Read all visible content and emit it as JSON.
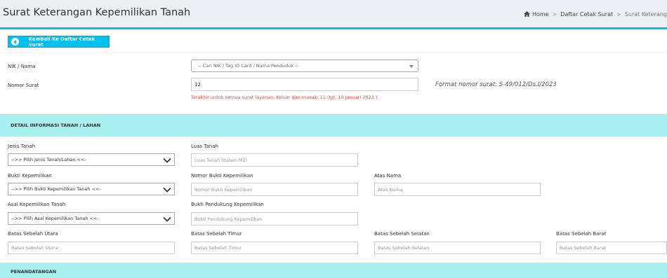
{
  "header": {
    "title": "Surat Keterangan Kepemilikan Tanah",
    "breadcrumb": {
      "home": "Home",
      "parent": "Daftar Cetak Surat",
      "current": "Surat Keterang"
    }
  },
  "toolbar": {
    "back_label": "Kembali Ke Daftar Cetak Surat"
  },
  "form": {
    "nik_label": "NIK / Nama",
    "nik_placeholder": "-- Cari NIK / Tag ID Card / Nama Penduduk --",
    "nomor_label": "Nomor Surat",
    "nomor_value": "12",
    "nomor_help": "Terakhir untuk semua surat layanan, keluar dan masuk: 11 (tgl: 10 Januari 2023 )",
    "format_text": "Format nomor surat: S-49/012/Ds.I/2023"
  },
  "section_tanah": {
    "title": "DETAIL INFORMASI TANAH / LAHAN",
    "jenis_label": "Jenis Tanah",
    "jenis_value": "-->> Pilih Jenis Tanah/Lahan <<-",
    "luas_label": "Luas Tanah",
    "luas_placeholder": "Luas Tanah (dalam M2)",
    "bukti_label": "Bukti Kepemilikan",
    "bukti_value": "-->> Pilih Bukti Kepemilikan Tanah <<-",
    "nomor_bukti_label": "Nomor Bukti Kepemilikan",
    "nomor_bukti_placeholder": "Nomor Bukti Kepemilikan",
    "atas_nama_label": "Atas Nama",
    "atas_nama_placeholder": "Atas Nama",
    "asal_label": "Asal Kepemilikan Tanah",
    "asal_value": "-->> Pilih Asal Kepemilikan Tanah <<-",
    "pendukung_label": "Bukti Pendukung Kepemilikan",
    "pendukung_placeholder": "Bukti Pendukung Kepemilikan",
    "utara_label": "Batas Sebelah Utara",
    "utara_placeholder": "Batas Sebelah Utara",
    "timur_label": "Batas Sebelah Timur",
    "timur_placeholder": "Batas Sebelah Timur",
    "selatan_label": "Batas Sebelah Selatan",
    "selatan_placeholder": "Batas Sebelah Selatan",
    "barat_label": "Batas Sebelah Barat",
    "barat_placeholder": "Batas Sebelah Barat"
  },
  "section_ttd": {
    "title": "PENANDATANGAN"
  },
  "colors": {
    "accent": "#00c0ef",
    "section_bg": "#a8efef",
    "error": "#dd4b39"
  }
}
